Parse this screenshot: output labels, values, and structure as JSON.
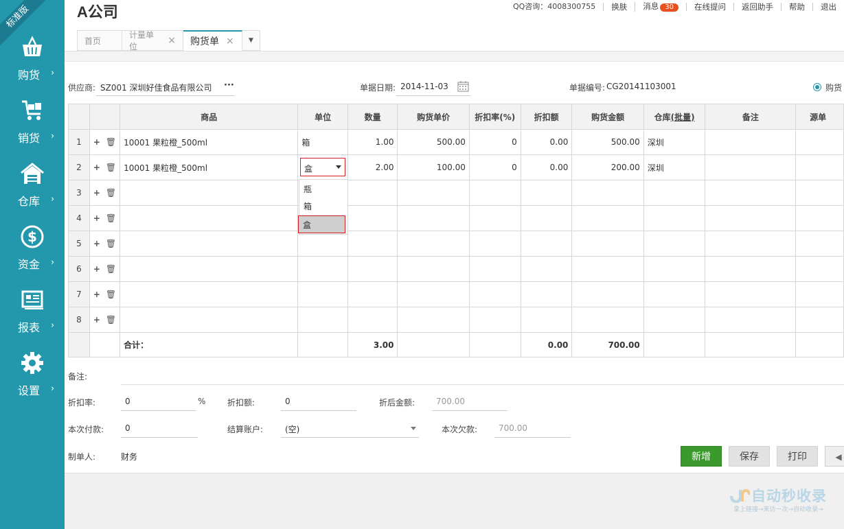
{
  "sidebar": {
    "ribbon": "标准版",
    "items": [
      {
        "label": "购货",
        "icon": "basket-icon"
      },
      {
        "label": "销货",
        "icon": "cart-icon"
      },
      {
        "label": "仓库",
        "icon": "warehouse-icon"
      },
      {
        "label": "资金",
        "icon": "dollar-icon"
      },
      {
        "label": "报表",
        "icon": "report-icon"
      },
      {
        "label": "设置",
        "icon": "gear-icon"
      }
    ],
    "arrow": "›"
  },
  "header": {
    "company": "A公司",
    "qq": "QQ咨询：4008300755",
    "skin": "换肤",
    "messages": "消息",
    "message_count": "30",
    "online_help": "在线提问",
    "return_helper": "返回助手",
    "help": "帮助",
    "logout": "退出"
  },
  "tabs": [
    {
      "label": "首页"
    },
    {
      "label": "计量单位",
      "close": "×"
    },
    {
      "label": "购货单",
      "close": "×"
    }
  ],
  "form": {
    "supplier_label": "供应商:",
    "supplier_value": "SZ001 深圳好佳食品有限公司",
    "supplier_more": "···",
    "date_label": "单据日期:",
    "date_value": "2014-11-03",
    "docno_label": "单据编号:",
    "docno_value": "CG20141103001",
    "type_label": "购货"
  },
  "grid": {
    "headers": {
      "product": "商品",
      "unit": "单位",
      "qty": "数量",
      "price": "购货单价",
      "discount_rate": "折扣率(%)",
      "discount_amount": "折扣额",
      "amount": "购货金额",
      "warehouse": "仓库",
      "batch": "(批量)",
      "remark": "备注",
      "source": "源单"
    },
    "rows": [
      {
        "n": "1",
        "product": "10001 果粒橙_500ml",
        "unit": "箱",
        "qty": "1.00",
        "price": "500.00",
        "rate": "0",
        "disc": "0.00",
        "amount": "500.00",
        "wh": "深圳"
      },
      {
        "n": "2",
        "product": "10001 果粒橙_500ml",
        "unit": "",
        "qty": "2.00",
        "price": "100.00",
        "rate": "0",
        "disc": "0.00",
        "amount": "200.00",
        "wh": "深圳"
      },
      {
        "n": "3"
      },
      {
        "n": "4"
      },
      {
        "n": "5"
      },
      {
        "n": "6"
      },
      {
        "n": "7"
      },
      {
        "n": "8"
      }
    ],
    "ops": {
      "add": "+",
      "del": "🗑"
    },
    "footer": {
      "label": "合计：",
      "qty": "3.00",
      "disc": "0.00",
      "amount": "700.00"
    }
  },
  "unit_dropdown": {
    "selected": "盒",
    "options": [
      "瓶",
      "箱",
      "盒"
    ]
  },
  "bottom": {
    "memo_label": "备注:",
    "rate_label": "折扣率:",
    "rate_value": "0",
    "rate_unit": "%",
    "disc_label": "折扣额:",
    "disc_value": "0",
    "after_label": "折后金额:",
    "after_value": "700.00",
    "pay_label": "本次付款:",
    "pay_value": "0",
    "acct_label": "结算账户:",
    "acct_value": "(空)",
    "owe_label": "本次欠款:",
    "owe_value": "700.00",
    "maker_label": "制单人:",
    "maker_value": "财务"
  },
  "buttons": {
    "new": "新增",
    "save": "保存",
    "print": "打印",
    "prev": "◀"
  },
  "watermark": {
    "title": "自动秒收录",
    "subtitle": "拿上链接→来访一次→自动收录→"
  }
}
